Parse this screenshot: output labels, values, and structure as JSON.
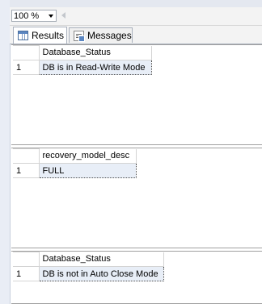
{
  "toolbar": {
    "zoom_value": "100 %"
  },
  "tabs": [
    {
      "label": "Results",
      "icon": "results-grid-icon",
      "active": true
    },
    {
      "label": "Messages",
      "icon": "messages-icon",
      "active": false
    }
  ],
  "results": [
    {
      "columns": [
        "Database_Status"
      ],
      "rows": [
        {
          "row_number": "1",
          "values": [
            "DB is in Read-Write Mode"
          ]
        }
      ]
    },
    {
      "columns": [
        "recovery_model_desc"
      ],
      "rows": [
        {
          "row_number": "1",
          "values": [
            "FULL"
          ]
        }
      ]
    },
    {
      "columns": [
        "Database_Status"
      ],
      "rows": [
        {
          "row_number": "1",
          "values": [
            "DB is not in Auto Close Mode"
          ]
        }
      ]
    }
  ]
}
